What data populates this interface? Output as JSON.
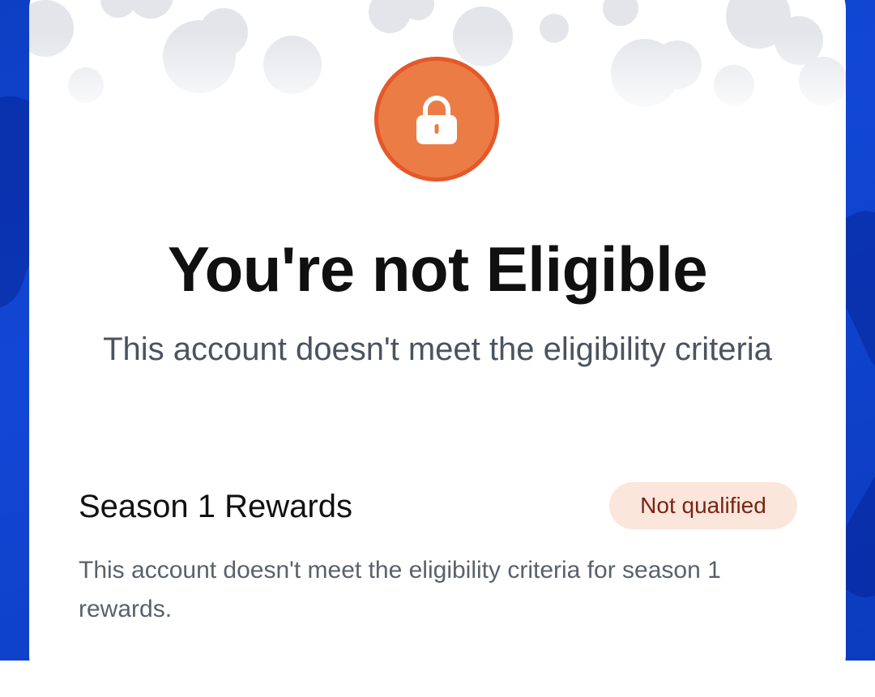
{
  "eligibility": {
    "status_icon": "lock-icon",
    "title": "You're not Eligible",
    "subtitle": "This account doesn't meet the eligibility criteria"
  },
  "rewards": {
    "section_title": "Season 1 Rewards",
    "badge_label": "Not qualified",
    "description": "This account doesn't meet the eligibility criteria for season 1 rewards."
  },
  "colors": {
    "background": "#1247d6",
    "lock_circle": "#ec7c46",
    "lock_ring": "#e4582a",
    "badge_bg": "#fbe6dc",
    "badge_text": "#7a2414"
  }
}
